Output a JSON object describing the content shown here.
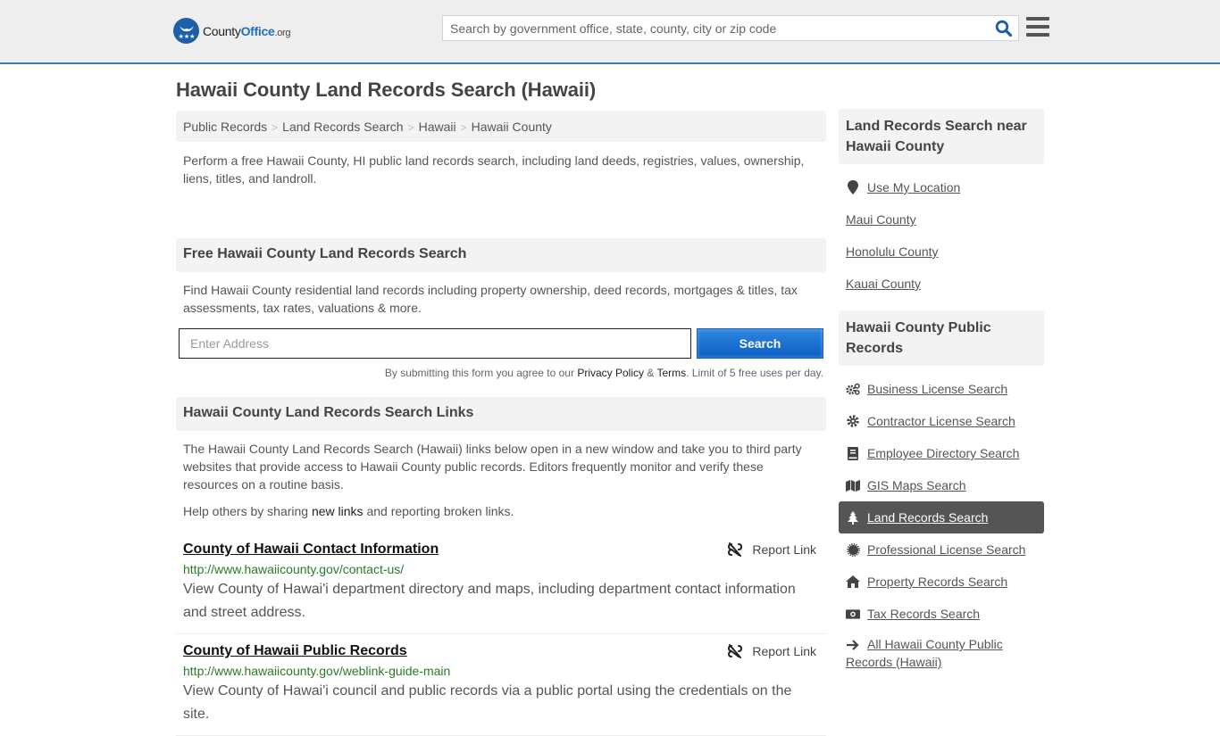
{
  "header": {
    "logo": {
      "county": "County",
      "office": "Office",
      "org": ".org"
    },
    "search_placeholder": "Search by government office, state, county, city or zip code",
    "search_icon": "search-icon",
    "menu_icon": "hamburger-menu-icon",
    "accent": "#3e7bad"
  },
  "page": {
    "title": "Hawaii County Land Records Search (Hawaii)"
  },
  "breadcrumb": [
    "Public Records",
    "Land Records Search",
    "Hawaii",
    "Hawaii County"
  ],
  "intro": "Perform a free Hawaii County, HI public land records search, including land deeds, registries, values, ownership, liens, titles, and landroll.",
  "search_form": {
    "heading": "Free Hawaii County Land Records Search",
    "description": "Find Hawaii County residential land records including property ownership, deed records, mortgages & titles, tax assessments, tax rates, valuations & more.",
    "address_placeholder": "Enter Address",
    "address_value": "",
    "submit_label": "Search",
    "disclaimer_prefix": "By submitting this form you agree to our ",
    "privacy_label": "Privacy Policy",
    "amp": " & ",
    "terms_label": "Terms",
    "disclaimer_suffix": ". Limit of 5 free uses per day."
  },
  "links_section": {
    "heading": "Hawaii County Land Records Search Links",
    "description": "The Hawaii County Land Records Search (Hawaii) links below open in a new window and take you to third party websites that provide access to Hawaii County public records. Editors frequently monitor and verify these resources on a routine basis.",
    "help_prefix": "Help others by sharing ",
    "help_link": "new links",
    "help_suffix": " and reporting broken links.",
    "report_label": "Report Link",
    "items": [
      {
        "title": "County of Hawaii Contact Information",
        "url": "http://www.hawaiicounty.gov/contact-us/",
        "description": "View County of Hawai'i department directory and maps, including department contact information and street address."
      },
      {
        "title": "County of Hawaii Public Records",
        "url": "http://www.hawaiicounty.gov/weblink-guide-main",
        "description": "View County of Hawai'i council and public records via a public portal using the credentials on the site."
      }
    ]
  },
  "sidebar": {
    "nearby": {
      "heading": "Land Records Search near Hawaii County",
      "use_location": "Use My Location",
      "items": [
        "Maui County",
        "Honolulu County",
        "Kauai County"
      ]
    },
    "public_records": {
      "heading": "Hawaii County Public Records",
      "items": [
        {
          "label": "Business License Search",
          "icon": "cogs-icon"
        },
        {
          "label": "Contractor License Search",
          "icon": "gear-icon"
        },
        {
          "label": "Employee Directory Search",
          "icon": "book-icon"
        },
        {
          "label": "GIS Maps Search",
          "icon": "map-icon"
        },
        {
          "label": "Land Records Search",
          "icon": "tree-icon",
          "active": true
        },
        {
          "label": "Professional License Search",
          "icon": "certificate-icon"
        },
        {
          "label": "Property Records Search",
          "icon": "home-icon"
        },
        {
          "label": "Tax Records Search",
          "icon": "money-icon"
        },
        {
          "label": "All Hawaii County Public Records (Hawaii)",
          "icon": "arrow-right-icon"
        }
      ]
    }
  }
}
